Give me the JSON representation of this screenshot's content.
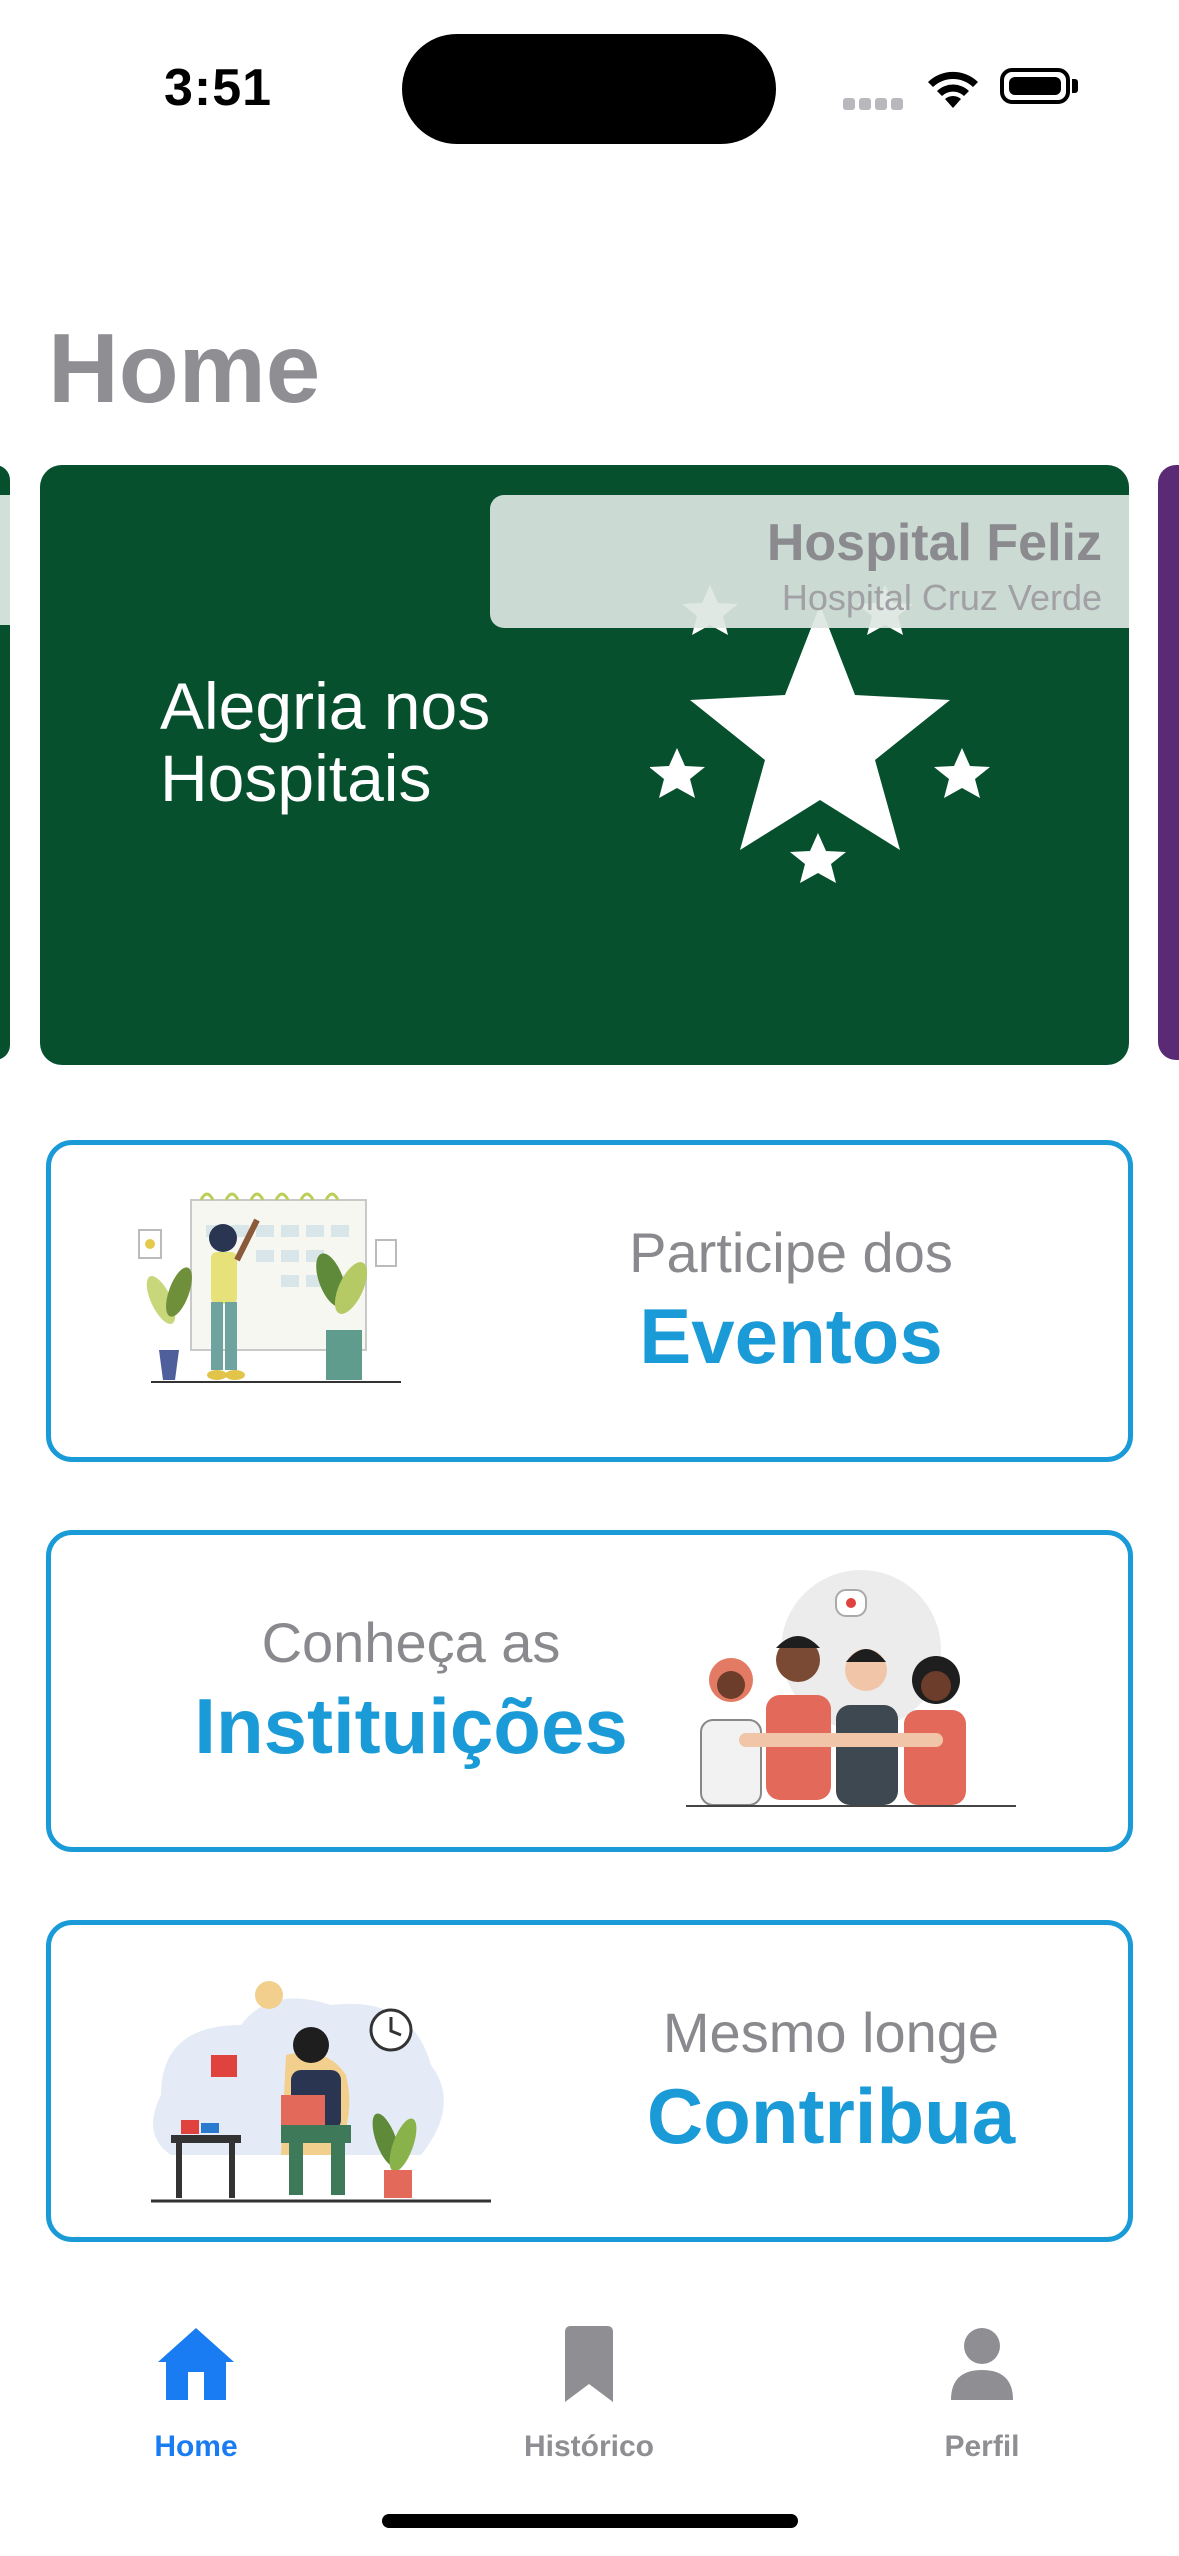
{
  "status_bar": {
    "time": "3:51"
  },
  "page": {
    "title": "Home"
  },
  "carousel": {
    "slide": {
      "title": "Hospital Feliz",
      "subtitle": "Hospital Cruz Verde",
      "image_text_line1": "Alegria nos",
      "image_text_line2": "Hospitais"
    }
  },
  "cards": [
    {
      "small": "Participe dos",
      "big": "Eventos"
    },
    {
      "small": "Conheça as",
      "big": "Instituições"
    },
    {
      "small": "Mesmo longe",
      "big": "Contribua"
    }
  ],
  "tabbar": {
    "items": [
      {
        "label": "Home",
        "icon": "house-icon",
        "active": true
      },
      {
        "label": "Histórico",
        "icon": "bookmark-icon",
        "active": false
      },
      {
        "label": "Perfil",
        "icon": "person-icon",
        "active": false
      }
    ],
    "active_color": "#1a7cf2",
    "inactive_color": "#8e8e93"
  },
  "colors": {
    "accent": "#1a9bd7",
    "slide_bg": "#07502e"
  }
}
